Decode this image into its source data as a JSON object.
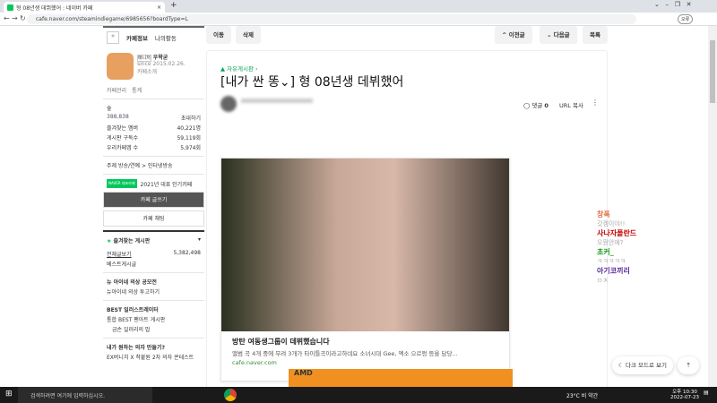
{
  "browser": {
    "tab_title": "형 08년생 데뷔했어 : 네이버 카페",
    "url": "cafe.naver.com/steamindiegame/6985656?boardType=L",
    "profile": "오류"
  },
  "sidebar": {
    "tabs": [
      "카페정보",
      "나의활동"
    ],
    "manager_badge": "매니저",
    "manager": "우왁굳",
    "since": "since 2015.02.26.",
    "cafe_intro": "카페소개",
    "cafe_manage": "카페관리",
    "stats": "통계",
    "level": "숲",
    "members": "388,838",
    "invite": "초대하기",
    "info": [
      {
        "label": "즐겨찾는 멤버",
        "value": "40,221명"
      },
      {
        "label": "게시판 구독수",
        "value": "59,119회"
      },
      {
        "label": "우리카페앱 수",
        "value": "5,974회"
      }
    ],
    "topic": "주제  방송/연예 > 인터넷방송",
    "naver_badge": "NAVER 대표카페",
    "award": "2021년 대표 인기카페",
    "write_btn": "카페 글쓰기",
    "chat_btn": "카페 채팅",
    "fav_title": "즐겨찾는 게시판",
    "boards": [
      {
        "label": "전체글보기",
        "count": "5,382,498"
      },
      {
        "label": "베스트게시글"
      }
    ],
    "sec1": "뉴 아이네 의상 공모전",
    "sec1_items": [
      "뉴아이네 의상 투고하기"
    ],
    "sec2": "BEST 일러스트레이터",
    "sec2_items": [
      "통합 BEST 팬아트 게시판",
      "금손 일러리의 밥"
    ],
    "sec3": "내가 원하는 의자 만들기?",
    "sec3_items": [
      "EX버니치 X 착붙원 2차 의자 콘테스트"
    ]
  },
  "toolbar": {
    "edit": "이동",
    "delete": "삭제",
    "prev": "이전글",
    "next": "다음글",
    "list": "목록"
  },
  "article": {
    "board": "자유게시판",
    "title": "[내가 싼 똥⌄] 형 08년생 데뷔했어",
    "comments_label": "댓글",
    "comments": "0",
    "url_copy": "URL 복사",
    "card_title": "방탄 여동생그룹이 데뷔했습니다",
    "card_desc": "앨범 곡 4개 중에 무려 3개가 타이틀곡이라고하네요 소녀시대 Gee, 엑소 으르렁 등을 담당...",
    "card_domain": "cafe.naver.com",
    "ad": "AMD"
  },
  "chat": [
    {
      "name": "창폭",
      "msg": "갓겜이야!!",
      "color": "#e07040"
    },
    {
      "name": "사나자폴란드",
      "msg": "오뭔안에?",
      "color": "#c00000"
    },
    {
      "name": "초커_",
      "msg": "ㅋㅋㅋㅋㅋ",
      "color": "#1a9a1a"
    },
    {
      "name": "아기코끼리",
      "msg": "ㅁㅊ",
      "color": "#5a2a9a"
    }
  ],
  "dark_mode": "다크 모드로 보기",
  "taskbar": {
    "search": "검색하려면 여기에 입력하십시오.",
    "weather": "23°C 비 약간",
    "time": "오후 10:30",
    "date": "2022-07-23"
  }
}
